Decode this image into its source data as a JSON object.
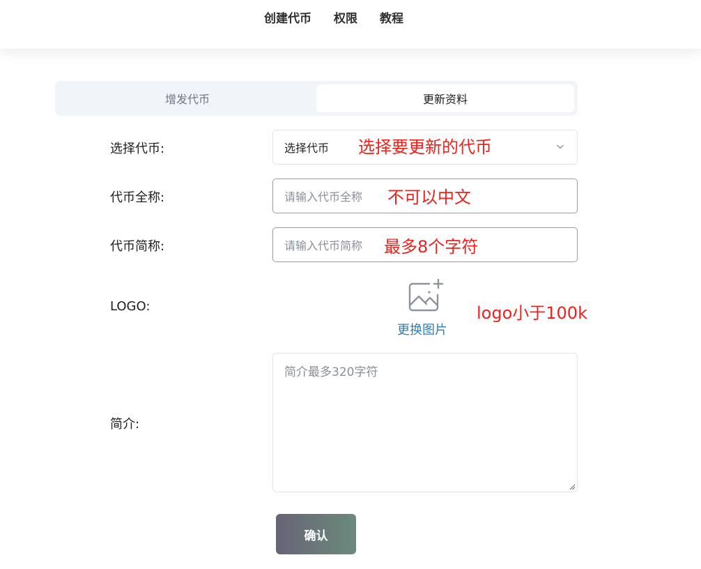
{
  "nav": {
    "items": [
      {
        "label": "创建代币"
      },
      {
        "label": "权限"
      },
      {
        "label": "教程"
      }
    ]
  },
  "tabs": [
    {
      "label": "增发代币",
      "active": false
    },
    {
      "label": "更新资料",
      "active": true
    }
  ],
  "form": {
    "token_select": {
      "label": "选择代币:",
      "value": "选择代币",
      "annotation": "选择要更新的代币",
      "icon": "chevron-down-icon"
    },
    "full_name": {
      "label": "代币全称:",
      "placeholder": "请输入代币全称",
      "annotation": "不可以中文"
    },
    "short_name": {
      "label": "代币简称:",
      "placeholder": "请输入代币简称",
      "annotation": "最多8个字符"
    },
    "logo": {
      "label": "LOGO:",
      "upload_label": "更换图片",
      "annotation": "logo小于100k",
      "icon": "image-add-icon"
    },
    "intro": {
      "label": "简介:",
      "placeholder": "简介最多320字符"
    },
    "confirm_label": "确认"
  },
  "colors": {
    "annotation": "#f0201a",
    "link": "#2f7fb0",
    "button_gradient_start": "#676476",
    "button_gradient_end": "#6c8a7b",
    "tab_bg": "#f1f4f8"
  }
}
